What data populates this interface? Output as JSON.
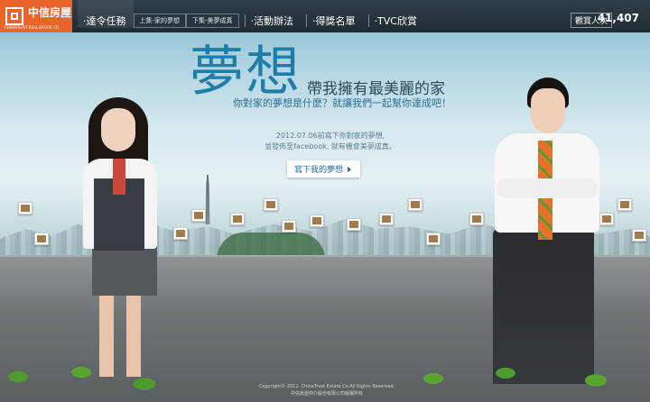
{
  "logo": {
    "name_cn": "中信房屋",
    "name_en": "CHINATRUST REAL ESTATE CO."
  },
  "nav": {
    "items": [
      {
        "label": "‧達令任務",
        "sub": [
          "上集-家的夢想",
          "下集-美夢成真"
        ]
      },
      {
        "label": "‧活動辦法"
      },
      {
        "label": "‧得獎名單"
      },
      {
        "label": "‧TVC欣賞"
      }
    ]
  },
  "visitors": {
    "label": "觀賞人次",
    "count": "41,407"
  },
  "hero": {
    "title_big": "夢想",
    "title_small": "帶我擁有最美麗的家",
    "subtitle": "你對家的夢想是什麼？就讓我們一起幫你達成吧！",
    "info_line1": "2012.07.06前寫下你對家的夢想,",
    "info_line2": "並發佈至facebook, 就有機會美夢成真。",
    "cta": "寫下我的夢想"
  },
  "footer": {
    "copyright_en": "Copyright© 2012. ChinaTrust Estate Co,All Rights Reserved.",
    "copyright_cn": "中信房屋仲介股份有限公司版權所有"
  },
  "colors": {
    "brand": "#e8642b",
    "accent": "#1f7da9",
    "bar": "#1f2c33"
  }
}
